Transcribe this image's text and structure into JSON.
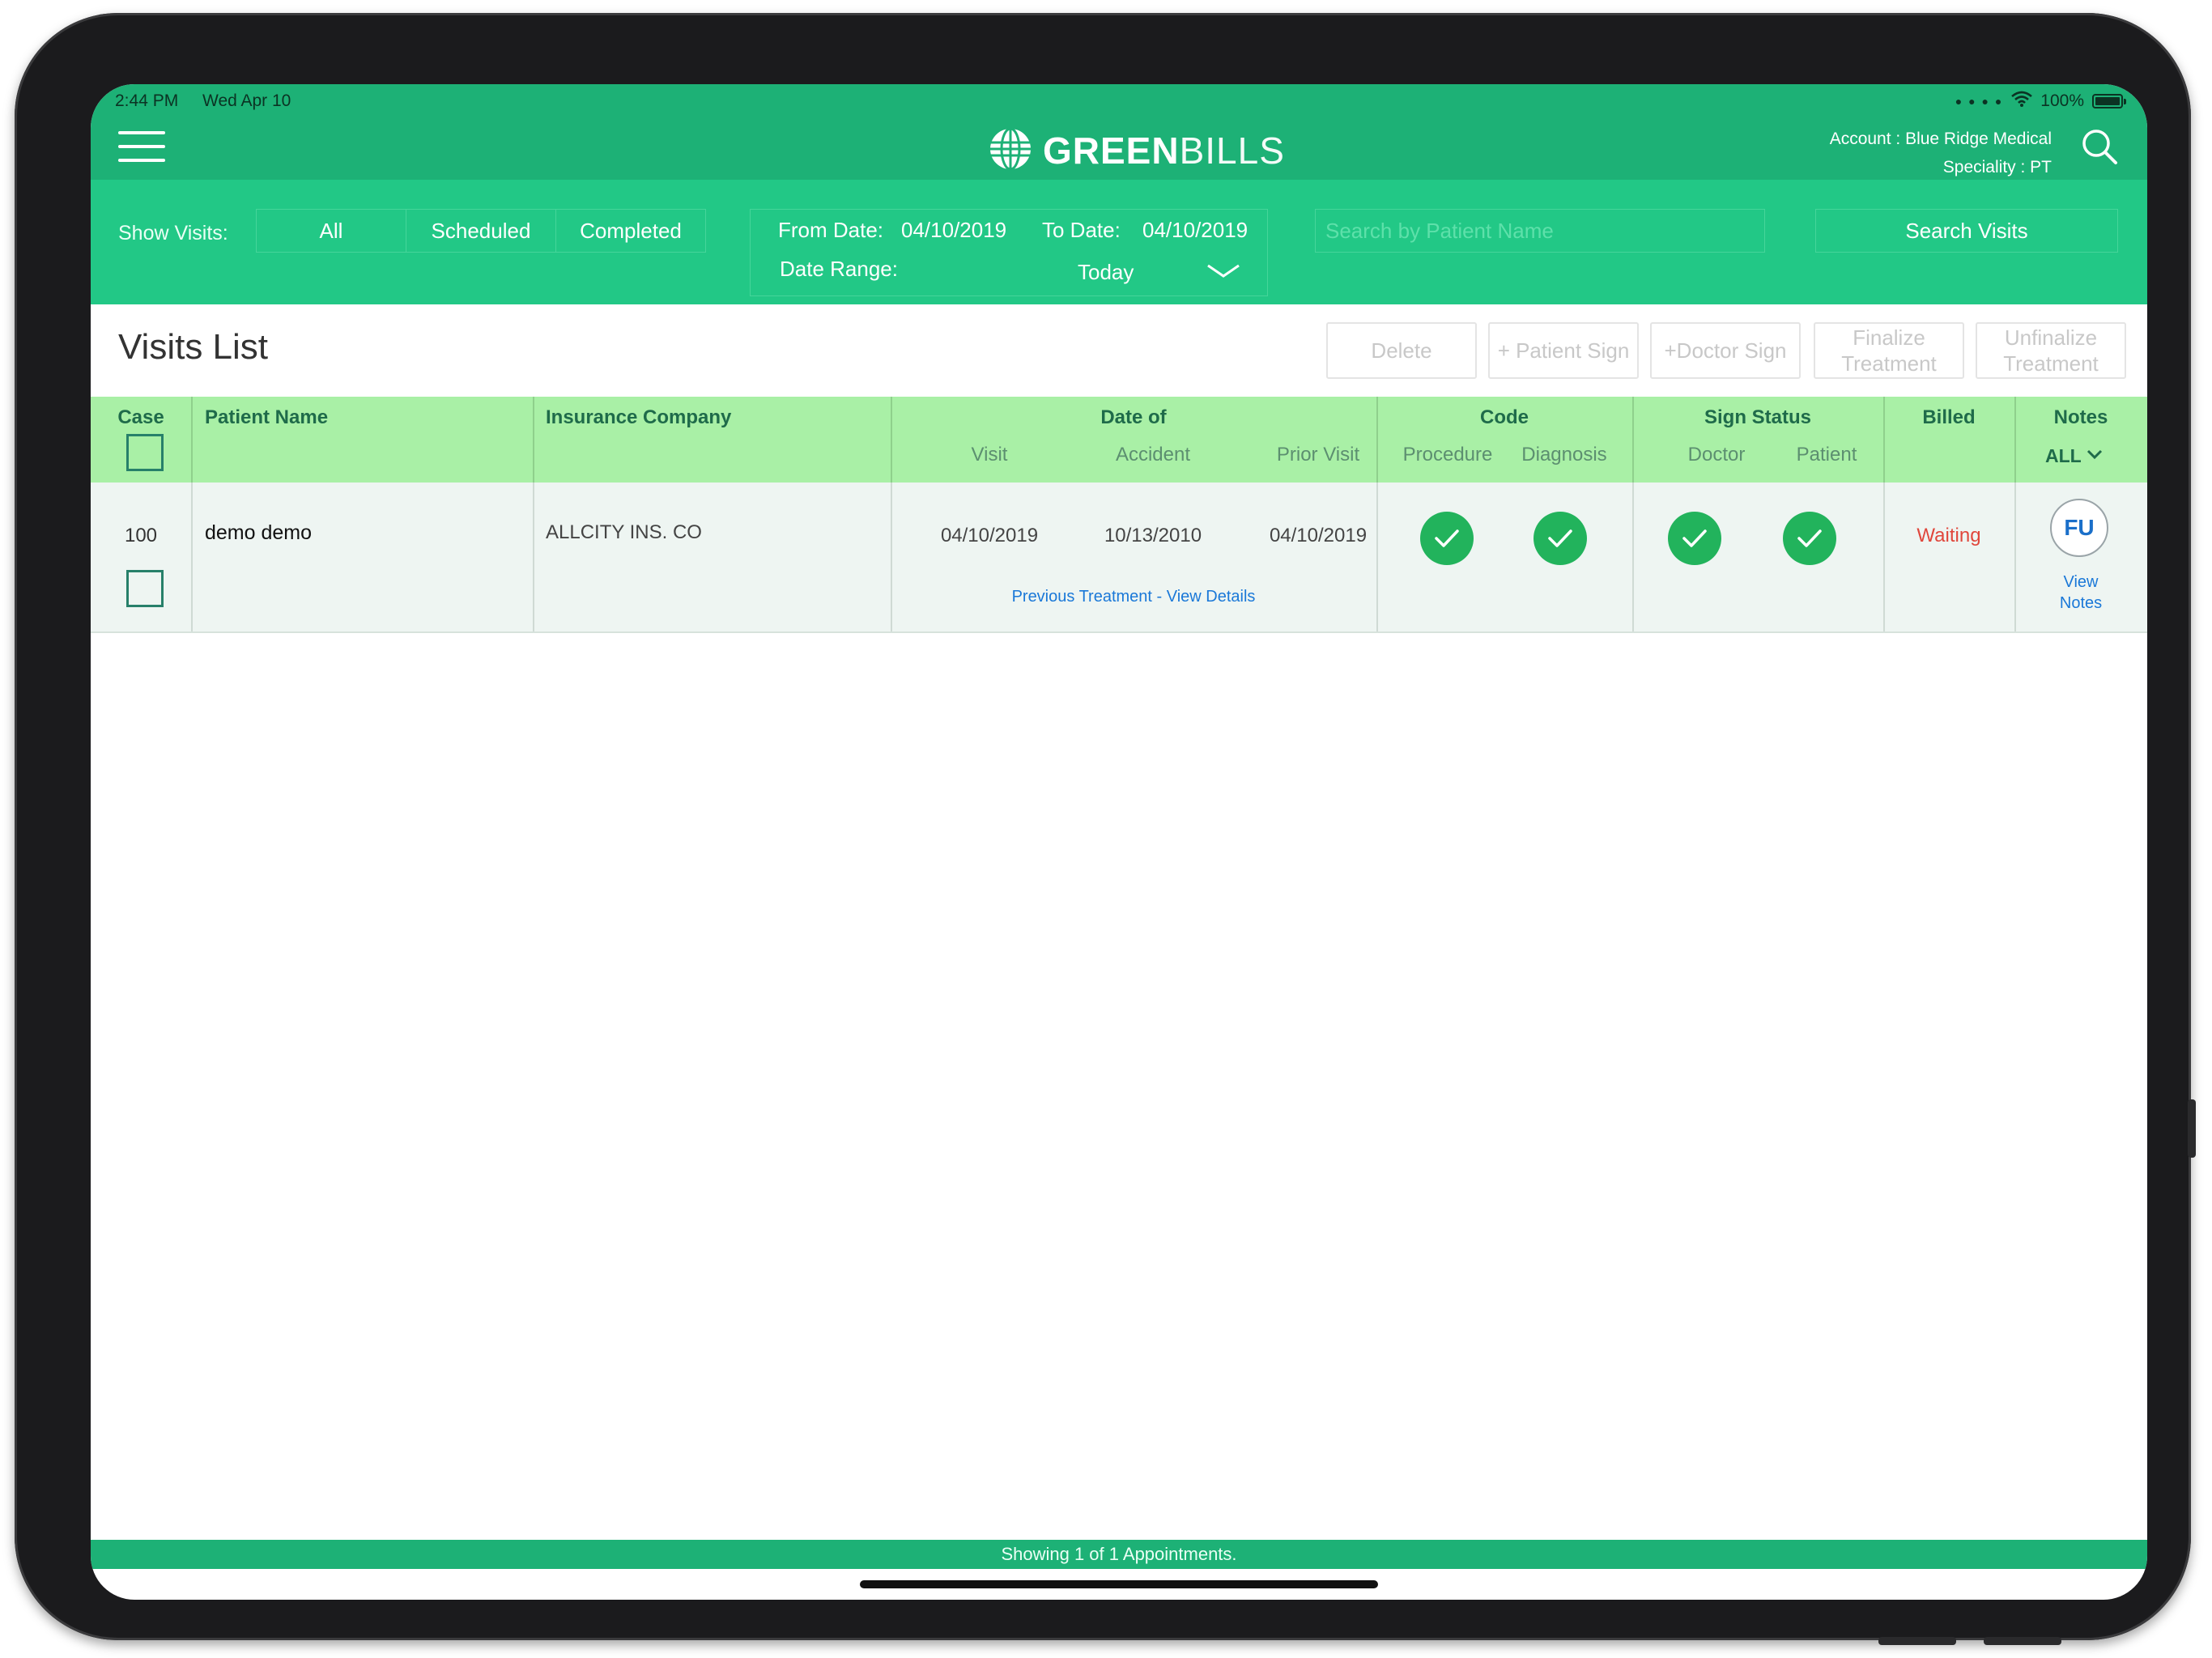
{
  "status_bar": {
    "time": "2:44 PM",
    "date": "Wed Apr 10",
    "battery": "100%"
  },
  "header": {
    "brand_bold": "GREEN",
    "brand_light": "BILLS",
    "account": "Account : Blue Ridge Medical",
    "speciality": "Speciality : PT"
  },
  "filters": {
    "show_visits_label": "Show Visits:",
    "segments": [
      "All",
      "Scheduled",
      "Completed"
    ],
    "from_date_label": "From Date:",
    "from_date_value": "04/10/2019",
    "to_date_label": "To Date:",
    "to_date_value": "04/10/2019",
    "date_range_label": "Date Range:",
    "date_range_value": "Today",
    "search_placeholder": "Search by Patient Name",
    "search_button": "Search Visits"
  },
  "visits_list": {
    "title": "Visits List",
    "actions": {
      "delete": "Delete",
      "patient_sign": "+ Patient Sign",
      "doctor_sign": "+Doctor Sign",
      "finalize_line1": "Finalize",
      "finalize_line2": "Treatment",
      "unfinalize_line1": "Unfinalize",
      "unfinalize_line2": "Treatment"
    }
  },
  "table": {
    "headers": {
      "case": "Case",
      "patient_name": "Patient Name",
      "insurance_company": "Insurance Company",
      "date_of": "Date of",
      "date_visit": "Visit",
      "date_accident": "Accident",
      "date_prior_visit": "Prior Visit",
      "code": "Code",
      "code_procedure": "Procedure",
      "code_diagnosis": "Diagnosis",
      "sign_status": "Sign Status",
      "sign_doctor": "Doctor",
      "sign_patient": "Patient",
      "billed": "Billed",
      "notes": "Notes",
      "notes_filter": "ALL"
    },
    "rows": [
      {
        "case": "100",
        "patient_name": "demo demo",
        "insurance_company": "ALLCITY INS. CO",
        "visit_date": "04/10/2019",
        "accident_date": "10/13/2010",
        "prior_visit_date": "04/10/2019",
        "previous_treatment_link": "Previous Treatment - View Details",
        "billed": "Waiting",
        "notes_badge": "FU",
        "view_notes_line1": "View",
        "view_notes_line2": "Notes"
      }
    ]
  },
  "footer": {
    "summary": "Showing 1 of 1 Appointments."
  },
  "colors": {
    "header_green": "#1db176",
    "filter_green": "#22c886",
    "table_head_green": "#a9f0a6",
    "check_green": "#22b35c",
    "waiting_red": "#e0473c",
    "link_blue": "#1a78d8"
  }
}
